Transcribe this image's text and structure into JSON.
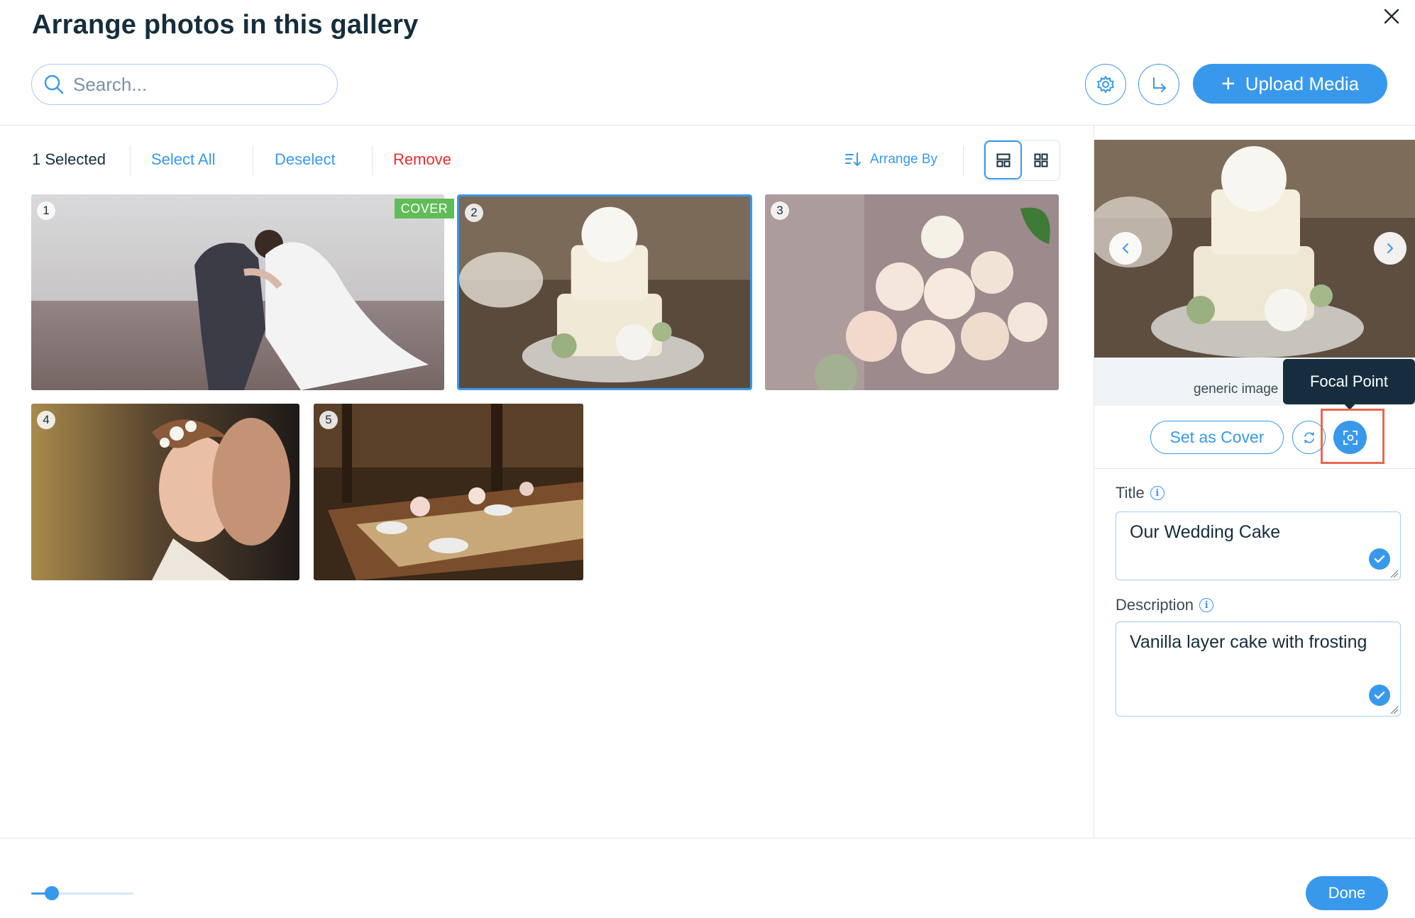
{
  "header": {
    "title": "Arrange photos in this gallery",
    "close_icon": "close-icon"
  },
  "search": {
    "placeholder": "Search...",
    "value": ""
  },
  "toolbar_actions": {
    "settings_icon": "gear-icon",
    "export_icon": "arrow-turn-icon",
    "upload_label": "Upload Media"
  },
  "selection_bar": {
    "selected_count": "1 Selected",
    "select_all": "Select All",
    "deselect": "Deselect",
    "remove": "Remove",
    "arrange_by": "Arrange By",
    "view_modes": [
      "layout-view-icon",
      "grid-view-icon"
    ],
    "active_view": "layout-view-icon"
  },
  "photos": [
    {
      "number": "1",
      "subject": "wedding couple kiss",
      "cover": true,
      "selected": false
    },
    {
      "number": "2",
      "subject": "wedding cake",
      "cover": false,
      "selected": true
    },
    {
      "number": "3",
      "subject": "rose bouquet",
      "cover": false,
      "selected": false
    },
    {
      "number": "4",
      "subject": "bride and groom close-up",
      "cover": false,
      "selected": false
    },
    {
      "number": "5",
      "subject": "reception table",
      "cover": false,
      "selected": false
    }
  ],
  "cover_badge": "COVER",
  "details_panel": {
    "preview_caption": "generic image",
    "tooltip": "Focal Point",
    "set_cover": "Set as Cover",
    "replace_icon": "replace-icon",
    "focal_icon": "focal-point-icon",
    "title_label": "Title",
    "title_value": "Our Wedding Cake",
    "description_label": "Description",
    "description_value": "Vanilla layer cake with frosting"
  },
  "footer": {
    "thumbnail_size_fraction": 0.2,
    "done": "Done"
  },
  "colors": {
    "accent": "#3899ec",
    "text": "#162d3d",
    "danger": "#ee2b2b",
    "cover": "#60bc57",
    "highlight": "#e8694e"
  }
}
